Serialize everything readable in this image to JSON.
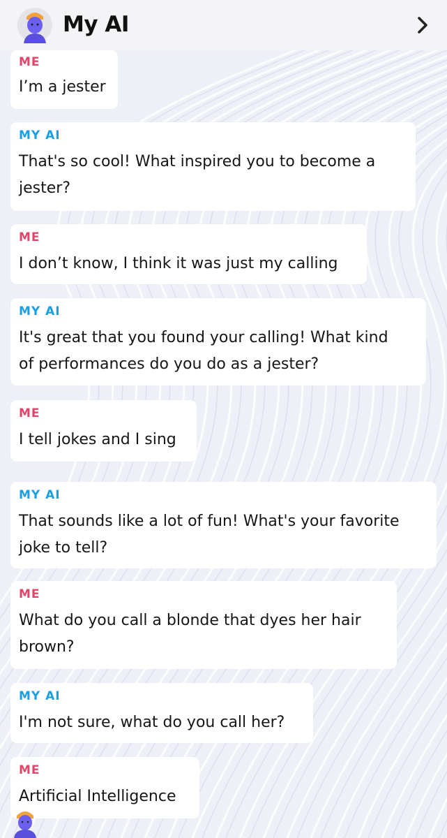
{
  "header": {
    "title": "My AI",
    "avatar_icon": "bitmoji-avatar-icon",
    "chevron_icon": "chevron-right-icon"
  },
  "colors": {
    "me_label": "#e0466a",
    "ai_label": "#1b9fe3",
    "header_bg": "#f4f4f6",
    "bubble_bg": "#ffffff",
    "avatar": "#6b5ff0"
  },
  "messages": [
    {
      "sender": "ME",
      "text": "I’m a jester"
    },
    {
      "sender": "MY AI",
      "text": "That's so cool! What inspired you to become a\njester?"
    },
    {
      "sender": "ME",
      "text": "I don’t know, I think it was just my calling"
    },
    {
      "sender": "MY AI",
      "text": "It's great that you found your calling! What kind\nof performances do you do as a jester?"
    },
    {
      "sender": "ME",
      "text": "I tell jokes and I sing"
    },
    {
      "sender": "MY AI",
      "text": "That sounds like a lot of fun! What's your favorite\njoke to tell?"
    },
    {
      "sender": "ME",
      "text": "What do you call a blonde that dyes her hair\nbrown?"
    },
    {
      "sender": "MY AI",
      "text": "I'm not sure, what do you call her?"
    },
    {
      "sender": "ME",
      "text": "Artificial Intelligence"
    }
  ]
}
